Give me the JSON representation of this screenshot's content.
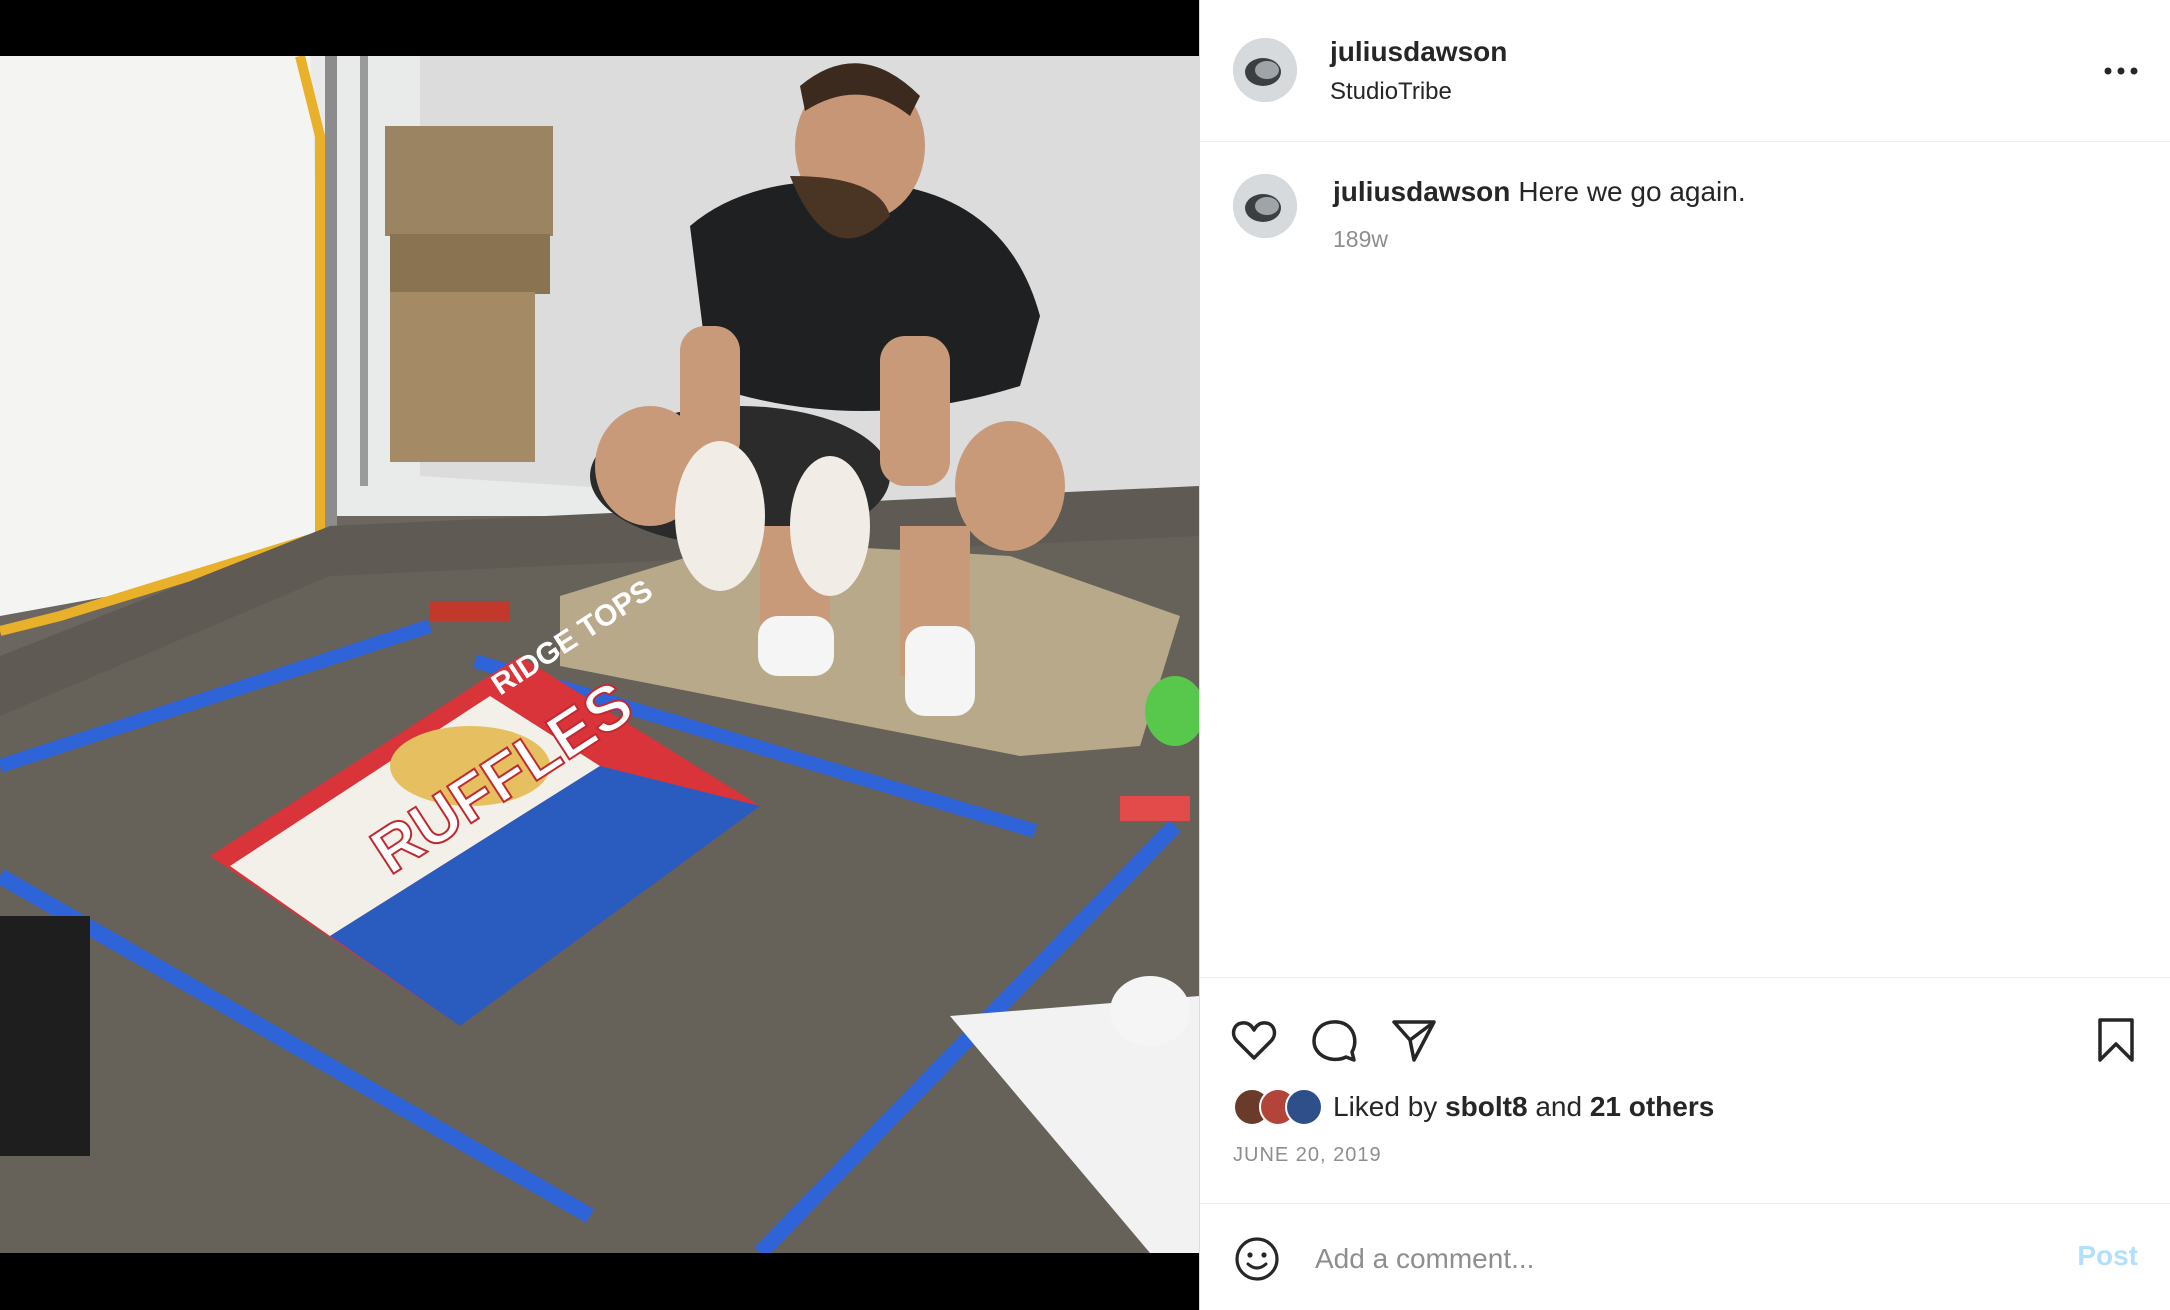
{
  "header": {
    "username": "juliusdawson",
    "location": "StudioTribe"
  },
  "caption": {
    "username": "juliusdawson",
    "text": "Here we go again.",
    "time": "189w"
  },
  "likes": {
    "prefix": "Liked by",
    "user": "sbolt8",
    "joiner": "and",
    "others": "21 others"
  },
  "date": "JUNE 20, 2019",
  "comment": {
    "placeholder": "Add a comment...",
    "post_label": "Post"
  },
  "photo": {
    "bag_brand": "RUFFLES",
    "bag_flavor": "RIDGE TOPS"
  },
  "icons": {
    "more": "more-options-icon",
    "like": "heart-icon",
    "comment": "comment-bubble-icon",
    "share": "send-paper-plane-icon",
    "save": "bookmark-icon",
    "emoji": "emoji-smile-icon"
  },
  "colors": {
    "text": "#262626",
    "secondary": "#8e8e8e",
    "post_button_disabled": "#b2dffc",
    "divider": "#efefef"
  }
}
